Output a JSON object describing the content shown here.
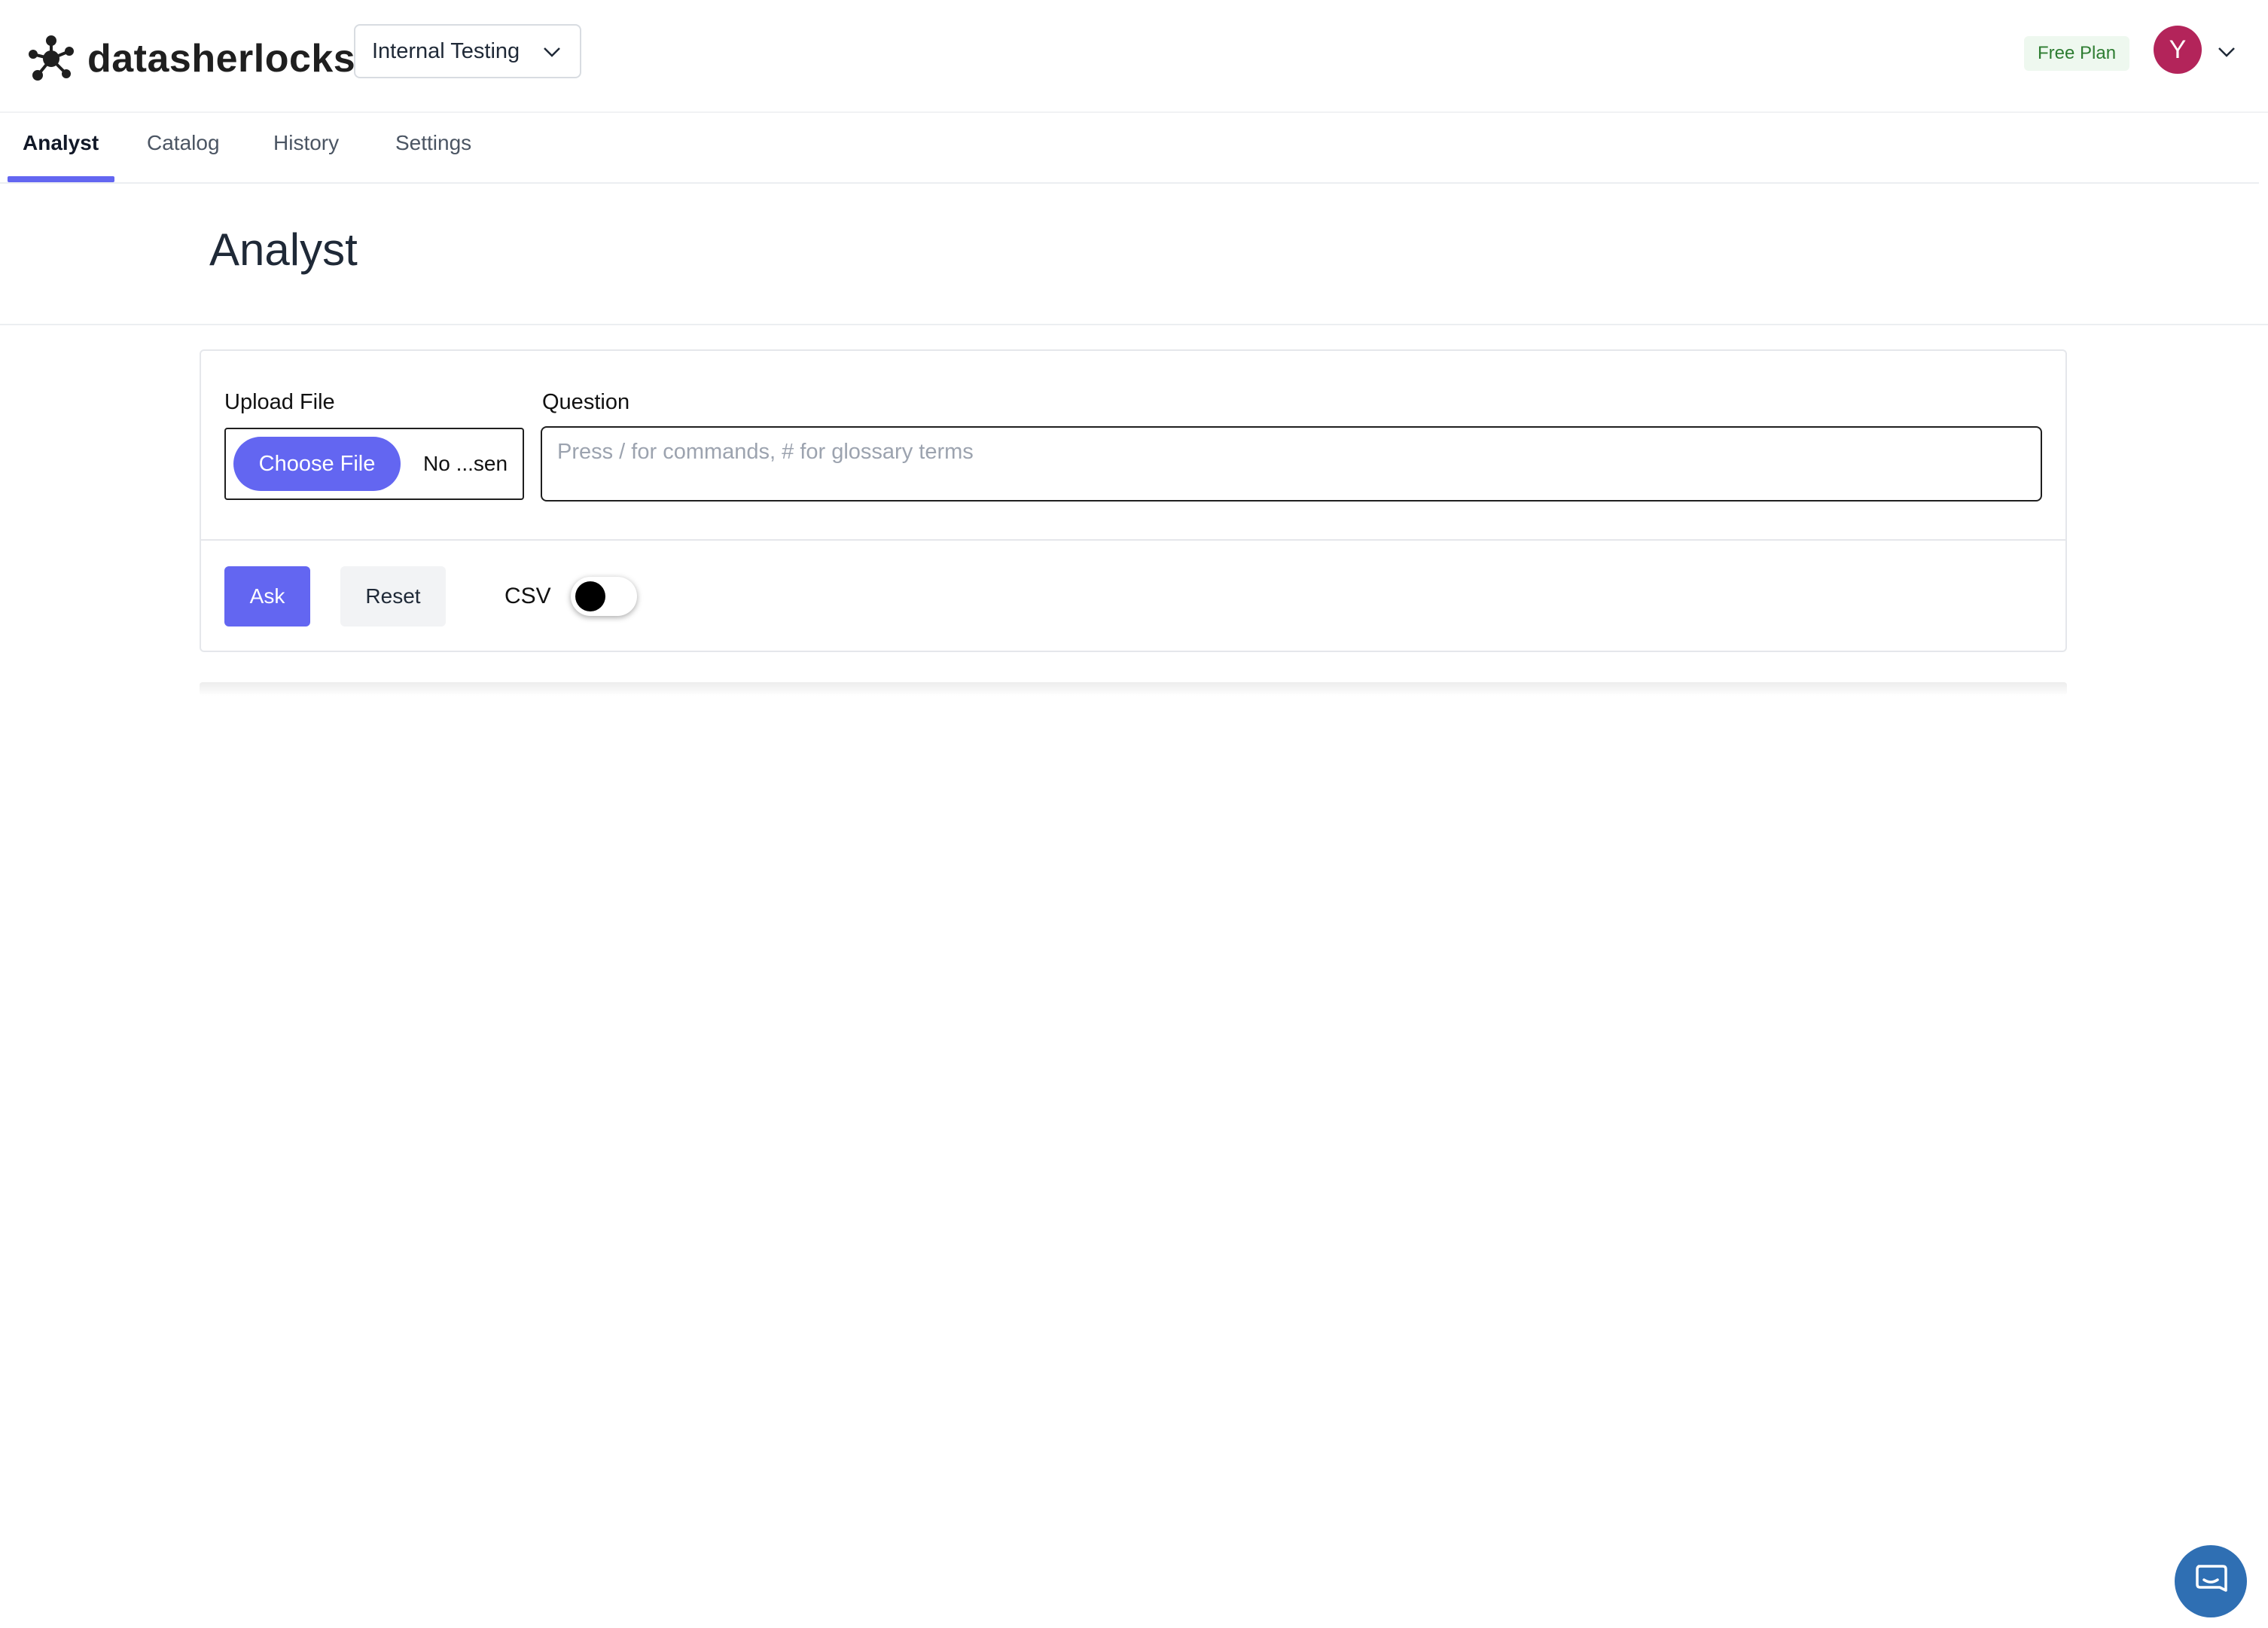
{
  "app": {
    "brand_name": "datasherlocks",
    "logo_icon": "network-nodes-icon"
  },
  "header": {
    "org_selector": {
      "value": "Internal Testing",
      "icon": "chevron-down-icon"
    },
    "plan_badge": "Free Plan",
    "avatar_initial": "Y",
    "avatar_color": "#b3245a"
  },
  "tabs": [
    {
      "label": "Analyst",
      "active": true
    },
    {
      "label": "Catalog",
      "active": false
    },
    {
      "label": "History",
      "active": false
    },
    {
      "label": "Settings",
      "active": false
    }
  ],
  "page": {
    "title": "Analyst"
  },
  "form": {
    "upload_label": "Upload File",
    "choose_file_label": "Choose File",
    "file_status": "No ...sen",
    "question_label": "Question",
    "question_placeholder": "Press / for commands, # for glossary terms",
    "question_value": "",
    "ask_label": "Ask",
    "reset_label": "Reset",
    "csv_label": "CSV",
    "csv_enabled": false
  },
  "colors": {
    "accent": "#6366f1",
    "plan_badge_text": "#2e7d32",
    "plan_badge_bg": "#eef8ef",
    "chat_launcher": "#2f6fb3"
  },
  "chat_launcher": {
    "icon": "chat-bubble-icon"
  }
}
